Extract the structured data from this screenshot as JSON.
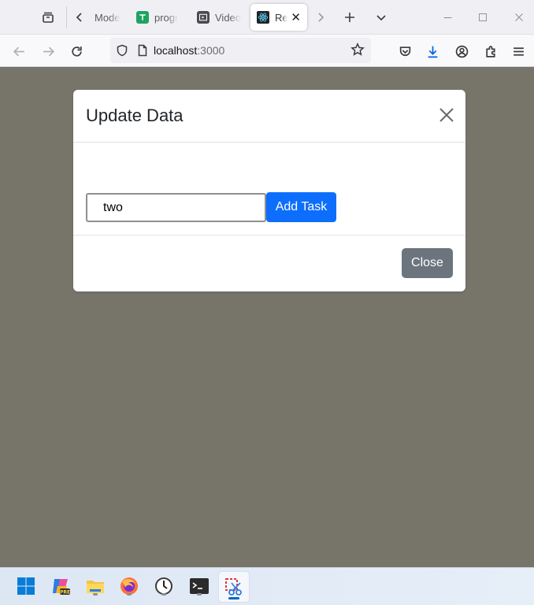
{
  "browser": {
    "tabs": [
      {
        "title": "Mode",
        "icon": "file-icon"
      },
      {
        "title": "progr",
        "icon": "sheets-icon"
      },
      {
        "title": "Video",
        "icon": "video-icon"
      },
      {
        "title": "Rea",
        "icon": "react-icon",
        "active": true
      }
    ],
    "url_host": "localhost",
    "url_port": ":3000"
  },
  "modal": {
    "title": "Update Data",
    "input_value": "two",
    "add_button_label": "Add Task",
    "close_button_label": "Close"
  },
  "colors": {
    "backdrop": "#77756a",
    "primary_button": "#0d6efd",
    "secondary_button": "#6c757d"
  },
  "taskbar": {
    "icons": [
      "windows-start-icon",
      "copilot-icon",
      "file-explorer-icon",
      "firefox-icon",
      "clock-icon",
      "terminal-icon",
      "snipping-tool-icon"
    ]
  }
}
